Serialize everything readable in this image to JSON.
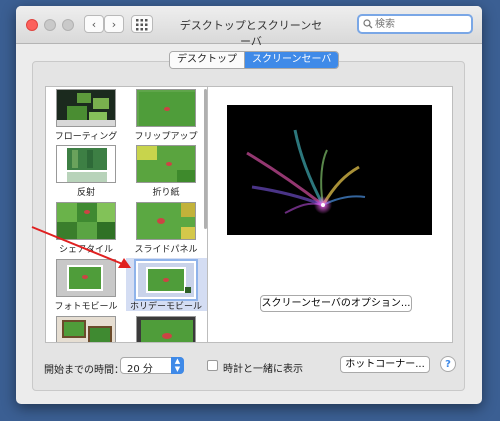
{
  "window": {
    "title": "デスクトップとスクリーンセーバ",
    "search_placeholder": "検索"
  },
  "tabs": [
    {
      "label": "デスクトップ",
      "selected": false
    },
    {
      "label": "スクリーンセーバ",
      "selected": true
    }
  ],
  "screensavers": [
    {
      "label": "フローティング"
    },
    {
      "label": "フリップアップ"
    },
    {
      "label": "反射"
    },
    {
      "label": "折り紙"
    },
    {
      "label": "シェアタイル"
    },
    {
      "label": "スライドパネル"
    },
    {
      "label": "フォトモビール"
    },
    {
      "label": "ホリデーモビール",
      "selected": true
    }
  ],
  "preview": {
    "options_button": "スクリーンセーバのオプション..."
  },
  "bottom": {
    "start_after_label": "開始までの時間：",
    "start_after_value": "20 分",
    "show_clock_label": "時計と一緒に表示",
    "show_clock_checked": false,
    "hot_corners_button": "ホットコーナー...",
    "help_label": "?"
  },
  "colors": {
    "accent": "#3f8ae8",
    "arrow": "#e02020"
  }
}
